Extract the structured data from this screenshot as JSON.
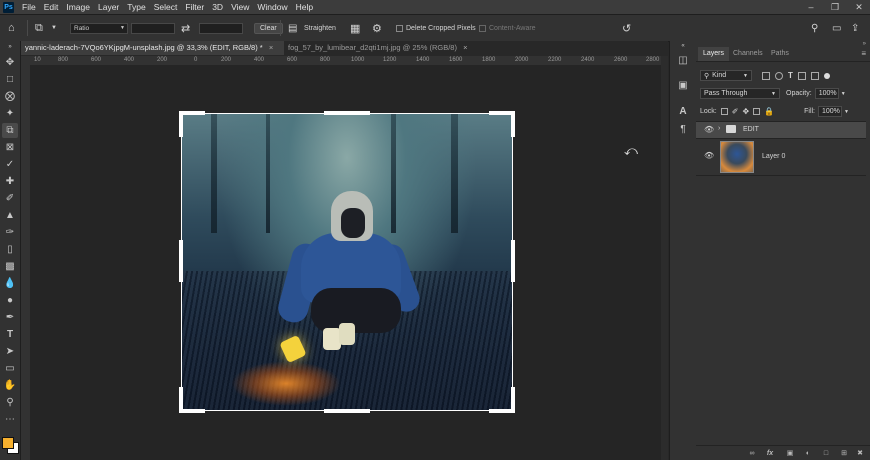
{
  "app": {
    "logo": "Ps"
  },
  "menu": [
    "File",
    "Edit",
    "Image",
    "Layer",
    "Type",
    "Select",
    "Filter",
    "3D",
    "View",
    "Window",
    "Help"
  ],
  "options": {
    "ratio": "Ratio",
    "clear_label": "Clear",
    "straighten_label": "Straighten",
    "delete_cropped_label": "Delete Cropped Pixels",
    "content_aware_label": "Content-Aware"
  },
  "tabs": [
    {
      "label": "yannic-laderach-7VQo6YKjpgM-unsplash.jpg @ 33,3% (EDIT, RGB/8) *"
    },
    {
      "label": "fog_57_by_lumibear_d2qti1mj.jpg @ 25% (RGB/8)"
    }
  ],
  "ruler": {
    "labels": [
      "10",
      "800",
      "600",
      "400",
      "200",
      "0",
      "200",
      "400",
      "600",
      "800",
      "1000",
      "1200",
      "1400",
      "1600",
      "1800",
      "2000",
      "2200",
      "2400",
      "2600",
      "2800"
    ]
  },
  "panel": {
    "tabs": [
      "Layers",
      "Channels",
      "Paths"
    ],
    "kind": "Kind",
    "blend_mode": "Pass Through",
    "opacity_label": "Opacity:",
    "opacity": "100%",
    "lock_label": "Lock:",
    "fill_label": "Fill:",
    "fill": "100%",
    "layers": [
      {
        "name": "EDIT",
        "type": "group"
      },
      {
        "name": "Layer 0",
        "type": "image"
      }
    ]
  },
  "colors": {
    "foreground": "#f6b02e",
    "background": "#ffffff",
    "accent": "#31a8ff"
  }
}
